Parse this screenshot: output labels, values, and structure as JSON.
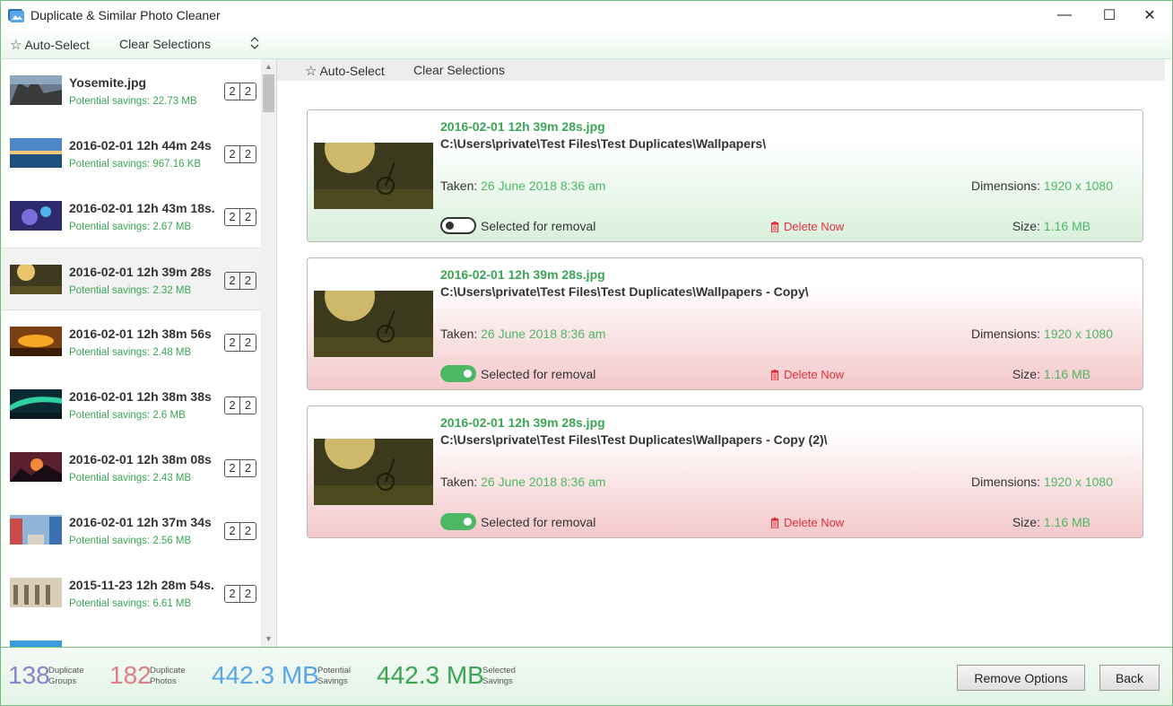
{
  "window": {
    "title": "Duplicate & Similar Photo Cleaner",
    "minimize_glyph": "—",
    "maximize_glyph": "☐",
    "close_glyph": "✕"
  },
  "toolbar": {
    "auto_select": "Auto-Select",
    "clear_selections": "Clear Selections"
  },
  "main_toolbar": {
    "auto_select": "Auto-Select",
    "clear_selections": "Clear Selections"
  },
  "sidebar": {
    "items": [
      {
        "title": "Yosemite.jpg",
        "savings": "Potential savings: 22.73 MB",
        "count_a": "2",
        "count_b": "2"
      },
      {
        "title": "2016-02-01 12h 44m 24s",
        "savings": "Potential savings: 967.16 KB",
        "count_a": "2",
        "count_b": "2"
      },
      {
        "title": "2016-02-01 12h 43m 18s.",
        "savings": "Potential savings: 2.67 MB",
        "count_a": "2",
        "count_b": "2"
      },
      {
        "title": "2016-02-01 12h 39m 28s",
        "savings": "Potential savings: 2.32 MB",
        "count_a": "2",
        "count_b": "2"
      },
      {
        "title": "2016-02-01 12h 38m 56s",
        "savings": "Potential savings: 2.48 MB",
        "count_a": "2",
        "count_b": "2"
      },
      {
        "title": "2016-02-01 12h 38m 38s",
        "savings": "Potential savings: 2.6 MB",
        "count_a": "2",
        "count_b": "2"
      },
      {
        "title": "2016-02-01 12h 38m 08s",
        "savings": "Potential savings: 2.43 MB",
        "count_a": "2",
        "count_b": "2"
      },
      {
        "title": "2016-02-01 12h 37m 34s",
        "savings": "Potential savings: 2.56 MB",
        "count_a": "2",
        "count_b": "2"
      },
      {
        "title": "2015-11-23 12h 28m 54s.",
        "savings": "Potential savings: 6.61 MB",
        "count_a": "2",
        "count_b": "2"
      }
    ],
    "selected_index": 3
  },
  "cards": [
    {
      "filename": "2016-02-01 12h 39m 28s.jpg",
      "path": "C:\\Users\\private\\Test Files\\Test Duplicates\\Wallpapers\\",
      "taken_label": "Taken:",
      "taken_value": "26 June 2018 8:36 am",
      "dims_label": "Dimensions:",
      "dims_value": "1920 x 1080",
      "toggle_label": "Selected for removal",
      "selected_for_removal": false,
      "delete_label": "Delete Now",
      "size_label": "Size:",
      "size_value": "1.16 MB"
    },
    {
      "filename": "2016-02-01 12h 39m 28s.jpg",
      "path": "C:\\Users\\private\\Test Files\\Test Duplicates\\Wallpapers - Copy\\",
      "taken_label": "Taken:",
      "taken_value": "26 June 2018 8:36 am",
      "dims_label": "Dimensions:",
      "dims_value": "1920 x 1080",
      "toggle_label": "Selected for removal",
      "selected_for_removal": true,
      "delete_label": "Delete Now",
      "size_label": "Size:",
      "size_value": "1.16 MB"
    },
    {
      "filename": "2016-02-01 12h 39m 28s.jpg",
      "path": "C:\\Users\\private\\Test Files\\Test Duplicates\\Wallpapers - Copy (2)\\",
      "taken_label": "Taken:",
      "taken_value": "26 June 2018 8:36 am",
      "dims_label": "Dimensions:",
      "dims_value": "1920 x 1080",
      "toggle_label": "Selected for removal",
      "selected_for_removal": true,
      "delete_label": "Delete Now",
      "size_label": "Size:",
      "size_value": "1.16 MB"
    }
  ],
  "stats": {
    "groups_num": "138",
    "groups_label_1": "Duplicate",
    "groups_label_2": "Groups",
    "photos_num": "182",
    "photos_label_1": "Duplicate",
    "photos_label_2": "Photos",
    "potential_num": "442.3 MB",
    "potential_label_1": "Potential",
    "potential_label_2": "Savings",
    "selected_num": "442.3 MB",
    "selected_label_1": "Selected",
    "selected_label_2": "Savings"
  },
  "buttons": {
    "remove_options": "Remove Options",
    "back": "Back"
  },
  "colors": {
    "accent_green": "#4cb865",
    "delete_red": "#e0313b",
    "groups_color": "#8b83c9",
    "photos_color": "#e07d88",
    "potential_color": "#5aa5e6",
    "selected_color": "#3aa653"
  }
}
